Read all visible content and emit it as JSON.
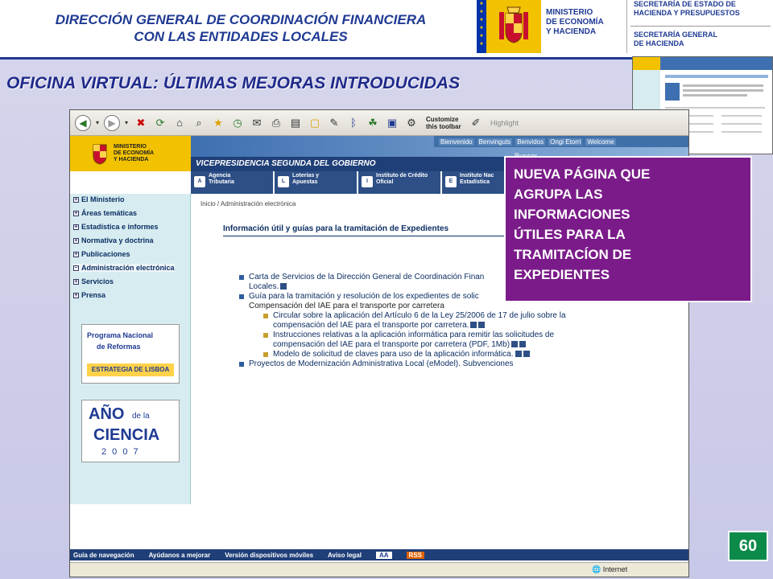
{
  "header": {
    "title_line1": "DIRECCIÓN GENERAL DE COORDINACIÓN FINANCIERA",
    "title_line2": "CON LAS ENTIDADES LOCALES",
    "ministry_line1": "MINISTERIO",
    "ministry_line2": "DE ECONOMÍA",
    "ministry_line3": "Y HACIENDA",
    "secretaria_estado_line1": "SECRETARÍA DE ESTADO DE",
    "secretaria_estado_line2": "HACIENDA Y PRESUPUESTOS",
    "secretaria_general_line1": "SECRETARÍA GENERAL",
    "secretaria_general_line2": "DE HACIENDA"
  },
  "slide_title": "OFICINA VIRTUAL: ÚLTIMAS MEJORAS INTRODUCIDAS",
  "browser": {
    "toolbar_customize": "Customize this toolbar",
    "toolbar_highlight": "Highlight",
    "status_zone": "Internet"
  },
  "site": {
    "logo_line1": "MINISTERIO",
    "logo_line2": "DE ECONOMÍA",
    "logo_line3": "Y HACIENDA",
    "languages": [
      "Bienvenido",
      "Benvinguts",
      "Benvidos",
      "Ongi Etorri",
      "Welcome"
    ],
    "buscar_label": "Buscar",
    "vice_banner": "VICEPRESIDENCIA SEGUNDA DEL GOBIERNO",
    "agencies": [
      {
        "line1": "Agencia",
        "line2": "Tributaria"
      },
      {
        "line1": "Loterías y",
        "line2": "Apuestas"
      },
      {
        "line1": "Instituto de Crédito",
        "line2": "Oficial"
      },
      {
        "line1": "Instituto Nac",
        "line2": "Estadística"
      }
    ],
    "sidebar": [
      {
        "label": "El Ministerio",
        "sign": "+"
      },
      {
        "label": "Áreas temáticas",
        "sign": "+"
      },
      {
        "label": "Estadística e informes",
        "sign": "+"
      },
      {
        "label": "Normativa y doctrina",
        "sign": "+"
      },
      {
        "label": "Publicaciones",
        "sign": "+"
      },
      {
        "label": "Administración electrónica",
        "sign": "−"
      },
      {
        "label": "Servicios",
        "sign": "+"
      },
      {
        "label": "Prensa",
        "sign": "+"
      }
    ],
    "badge1": {
      "line1": "Programa Nacional",
      "line2": "de Reformas",
      "line3": "ESTRATEGIA DE LISBOA"
    },
    "badge2": {
      "line1": "AÑO",
      "line2": "de la",
      "line3": "CIENCIA",
      "line4": "2 0 0 7"
    },
    "breadcrumb": "Inicio / Administración electrónica",
    "content_title": "Información útil y guías para la tramitación de Expedientes",
    "docs": [
      {
        "text": "Carta de Servicios de la Dirección General de Coordinación Finan",
        "text2": "Locales.",
        "level": "top"
      },
      {
        "text": "Guía para la tramitación y resolución de los expedientes de solic",
        "level": "top"
      },
      {
        "text": "Compensación del IAE para el transporte por carretera",
        "level": "heading"
      },
      {
        "text": "Circular sobre la aplicación del Artículo 6 de la Ley 25/2006 de 17 de julio sobre la",
        "text2": "compensación del IAE para el transporte por carretera.",
        "level": "sub"
      },
      {
        "text": "Instrucciones relativas a la aplicación informática para remitir las solicitudes de",
        "text2": "compensación del IAE para el transporte por carretera (PDF, 1Mb)",
        "level": "sub"
      },
      {
        "text": "Modelo de solicitud de claves para uso de la aplicación informática.",
        "level": "sub"
      },
      {
        "text": "Proyectos de Modernización Administrativa Local (eModel). Subvenciones",
        "level": "top"
      }
    ],
    "footer_links": [
      "Guía de navegación",
      "Ayúdanos a mejorar",
      "Versión dispositivos móviles",
      "Aviso legal"
    ],
    "footer_badge1": "AA",
    "footer_badge2": "RSS"
  },
  "callout": {
    "line1": "NUEVA PÁGINA QUE",
    "line2": "AGRUPA LAS",
    "line3": "INFORMACIONES",
    "line4": "ÚTILES PARA LA",
    "line5": "TRAMITACÍON DE",
    "line6": "EXPEDIENTES"
  },
  "page_number": "60",
  "colors": {
    "callout_bg": "#7b1b8a",
    "page_number_bg": "#0c8a4a",
    "title_blue": "#1f2a8a",
    "spain_yellow": "#f2c200"
  }
}
